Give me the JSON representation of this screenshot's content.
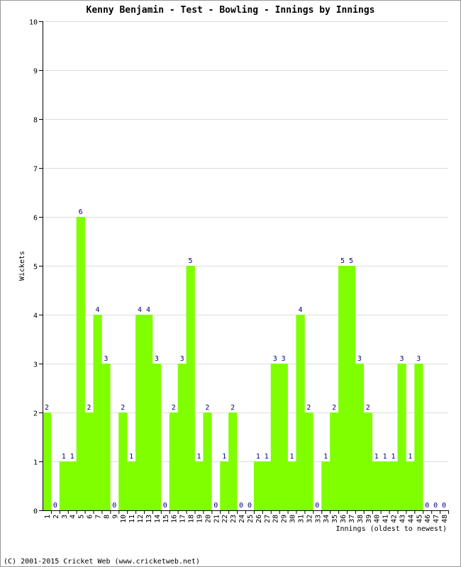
{
  "chart_data": {
    "type": "bar",
    "title": "Kenny Benjamin - Test - Bowling - Innings by Innings",
    "xlabel": "Innings (oldest to newest)",
    "ylabel": "Wickets",
    "ylim": [
      0,
      10
    ],
    "yticks": [
      0,
      1,
      2,
      3,
      4,
      5,
      6,
      7,
      8,
      9,
      10
    ],
    "grid": true,
    "categories": [
      "1",
      "2",
      "3",
      "4",
      "5",
      "6",
      "7",
      "8",
      "9",
      "10",
      "11",
      "12",
      "13",
      "14",
      "15",
      "16",
      "17",
      "18",
      "19",
      "20",
      "21",
      "22",
      "23",
      "24",
      "25",
      "26",
      "27",
      "28",
      "29",
      "30",
      "31",
      "32",
      "33",
      "34",
      "35",
      "36",
      "37",
      "38",
      "39",
      "40",
      "41",
      "42",
      "43",
      "44",
      "45",
      "46",
      "47",
      "48"
    ],
    "values": [
      2,
      0,
      1,
      1,
      6,
      2,
      4,
      3,
      0,
      2,
      1,
      4,
      4,
      3,
      0,
      2,
      3,
      5,
      1,
      2,
      0,
      1,
      2,
      0,
      0,
      1,
      1,
      3,
      3,
      1,
      4,
      2,
      0,
      1,
      2,
      5,
      5,
      3,
      2,
      1,
      1,
      1,
      3,
      1,
      3,
      0,
      0,
      0
    ],
    "bar_color": "#80ff00",
    "label_color": "#000080"
  },
  "footer": "(C) 2001-2015 Cricket Web (www.cricketweb.net)"
}
